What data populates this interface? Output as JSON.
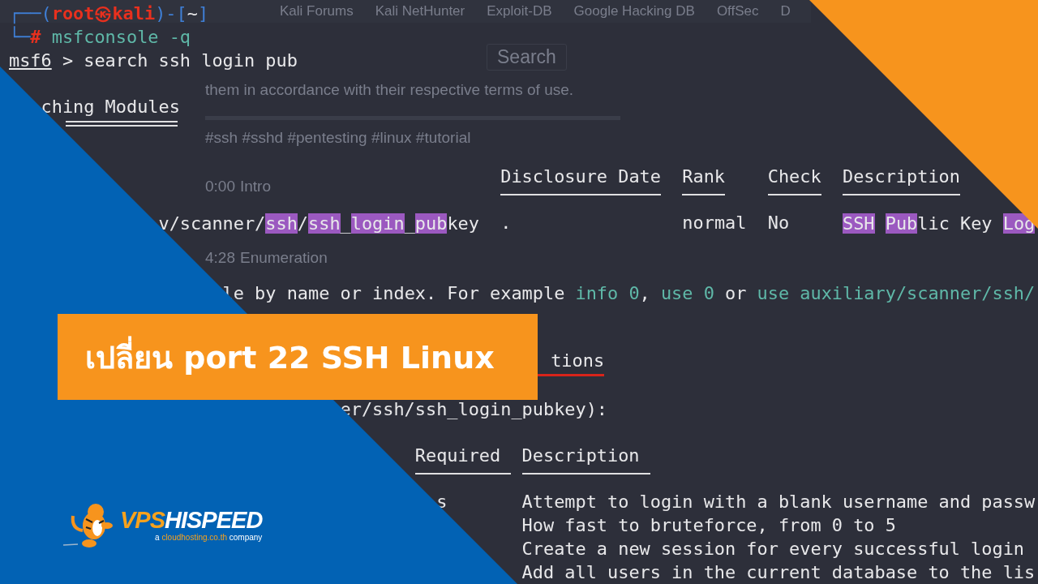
{
  "background_page": {
    "bookmarks": [
      "Kali Forums",
      "Kali NetHunter",
      "Exploit-DB",
      "Google Hacking DB",
      "OffSec",
      "D"
    ],
    "search_placeholder": "Search",
    "notice": "them in accordance with their respective terms of use.",
    "hashtags": "#ssh #sshd #pentesting #linux #tutorial",
    "chapters": [
      {
        "time": "0:00",
        "title": "Intro"
      },
      {
        "time": "4:28",
        "title": "Enumeration"
      }
    ]
  },
  "terminal": {
    "prompt": [
      {
        "kind": "frame",
        "text": "┌──("
      },
      {
        "kind": "user",
        "text": "root㉿kali"
      },
      {
        "kind": "frame",
        "text": ")-["
      },
      {
        "kind": "plain",
        "text": "~"
      },
      {
        "kind": "frame",
        "text": "]"
      }
    ],
    "command": [
      {
        "kind": "frame",
        "text": "└─"
      },
      {
        "kind": "user",
        "text": "# "
      },
      {
        "kind": "cmd",
        "text": "msfconsole -q"
      }
    ],
    "search_line": [
      {
        "kind": "underline",
        "text": "msf6"
      },
      {
        "kind": "plain",
        "text": " > search ssh login pub"
      }
    ],
    "heading": "ching Modules",
    "modules_table": {
      "columns": [
        "Disclosure Date",
        "Rank",
        "Check",
        "Description"
      ],
      "rows": [
        {
          "name": [
            {
              "text": "v/scanner/",
              "hl": false
            },
            {
              "text": "ssh",
              "hl": true
            },
            {
              "text": "/",
              "hl": false
            },
            {
              "text": "ssh",
              "hl": true
            },
            {
              "text": "_",
              "hl": false
            },
            {
              "text": "login",
              "hl": true
            },
            {
              "text": "_",
              "hl": false
            },
            {
              "text": "pub",
              "hl": true
            },
            {
              "text": "key",
              "hl": false
            }
          ],
          "disclosure_date": ".",
          "rank": "normal",
          "check": "No",
          "description": [
            {
              "text": "SSH",
              "hl": true
            },
            {
              "text": "Pub",
              "hl": true,
              "space_before": true
            },
            {
              "text": "lic Key ",
              "hl": false
            },
            {
              "text": "Log",
              "hl": true
            }
          ]
        }
      ]
    },
    "hint": [
      {
        "kind": "plain",
        "text": "le by name or index. For example "
      },
      {
        "kind": "cmd",
        "text": "info 0"
      },
      {
        "kind": "plain",
        "text": ", "
      },
      {
        "kind": "cmd",
        "text": "use 0"
      },
      {
        "kind": "plain",
        "text": " or "
      },
      {
        "kind": "cmd",
        "text": "use auxiliary/scanner/ssh/"
      }
    ],
    "options_heading": "tions",
    "options_title": "er/ssh/ssh_login_pubkey):",
    "options_table": {
      "columns": [
        "Required",
        "Description"
      ],
      "rows": [
        {
          "name": "s",
          "description": "Attempt to login with a blank username and passw"
        },
        {
          "description": "How fast to bruteforce, from 0 to 5"
        },
        {
          "description": "Create a new session for every successful login"
        },
        {
          "description": "Add all users in the current database to the lis"
        }
      ]
    }
  },
  "banner": {
    "title": "เปลี่ยน port 22 SSH Linux"
  },
  "logo": {
    "wordmark": [
      {
        "text": "VPS",
        "accent": true
      },
      {
        "text": "HISPEED",
        "accent": false
      }
    ],
    "tagline": [
      {
        "text": "a ",
        "accent": false
      },
      {
        "text": "cloudhosting.co.th",
        "accent": true
      },
      {
        "text": " company",
        "accent": false
      }
    ]
  }
}
